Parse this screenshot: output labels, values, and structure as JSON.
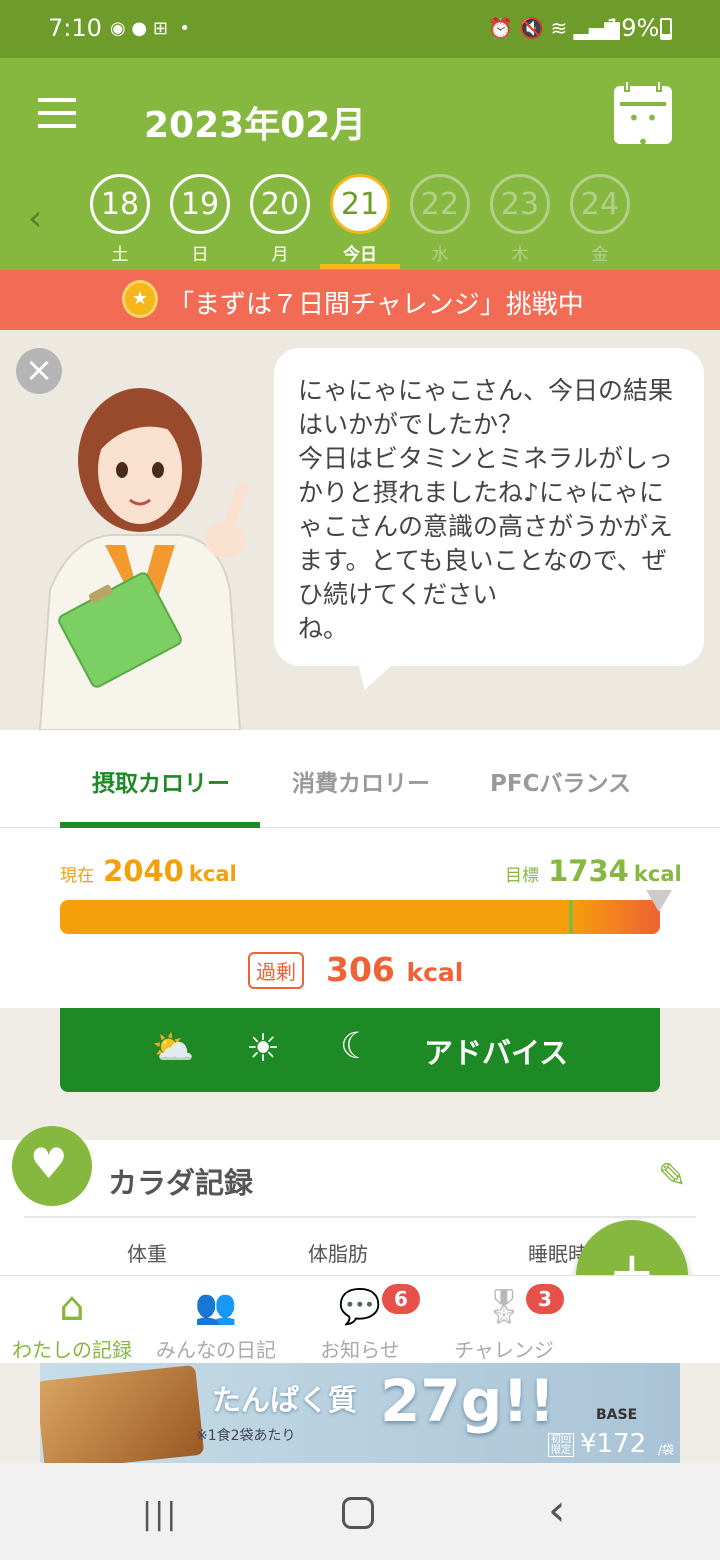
{
  "status_bar": {
    "time": "7:10",
    "battery": "19%"
  },
  "header": {
    "month_title": "2023年02月"
  },
  "dates": [
    {
      "num": "18",
      "label": "土"
    },
    {
      "num": "19",
      "label": "日"
    },
    {
      "num": "20",
      "label": "月"
    },
    {
      "num": "21",
      "label": "今日"
    },
    {
      "num": "22",
      "label": "水"
    },
    {
      "num": "23",
      "label": "木"
    },
    {
      "num": "24",
      "label": "金"
    }
  ],
  "challenge_banner": "「まずは７日間チャレンジ」挑戦中",
  "coach_message": "にゃにゃにゃこさん、今日の結果はいかがでしたか？\n今日はビタミンとミネラルがしっかりと摂れましたね♪にゃにゃにゃこさんの意識の高さがうかがえます。とても良いことなので、ぜひ続けてください\nね。",
  "tabs": [
    "摂取カロリー",
    "消費カロリー",
    "PFCバランス"
  ],
  "calories": {
    "current_label": "現在",
    "current_value": "2040",
    "target_label": "目標",
    "target_value": "1734",
    "unit": "kcal",
    "excess_label": "過剰",
    "excess_value": "306",
    "progress_ratio": 1.176
  },
  "advice_button": "アドバイス",
  "body_record": {
    "title": "カラダ記録",
    "columns": [
      "体重",
      "体脂肪",
      "睡眠時"
    ]
  },
  "bottom_nav": [
    {
      "label": "わたしの記録",
      "icon": "home-icon"
    },
    {
      "label": "みんなの日記",
      "icon": "people-icon"
    },
    {
      "label": "お知らせ",
      "icon": "chat-icon",
      "badge": "6"
    },
    {
      "label": "チャレンジ",
      "icon": "medal-icon",
      "badge": "3"
    }
  ],
  "ad": {
    "headline": "たんぱく質",
    "amount": "27g!!",
    "note": "※1食2袋あたり",
    "brand": "BASE",
    "price_label": "初回限定",
    "price": "¥172",
    "price_unit": "/袋"
  },
  "colors": {
    "brand_green": "#86b83f",
    "dark_green": "#1e8a25",
    "banner_red": "#f26b55",
    "orange": "#f5a00a"
  }
}
